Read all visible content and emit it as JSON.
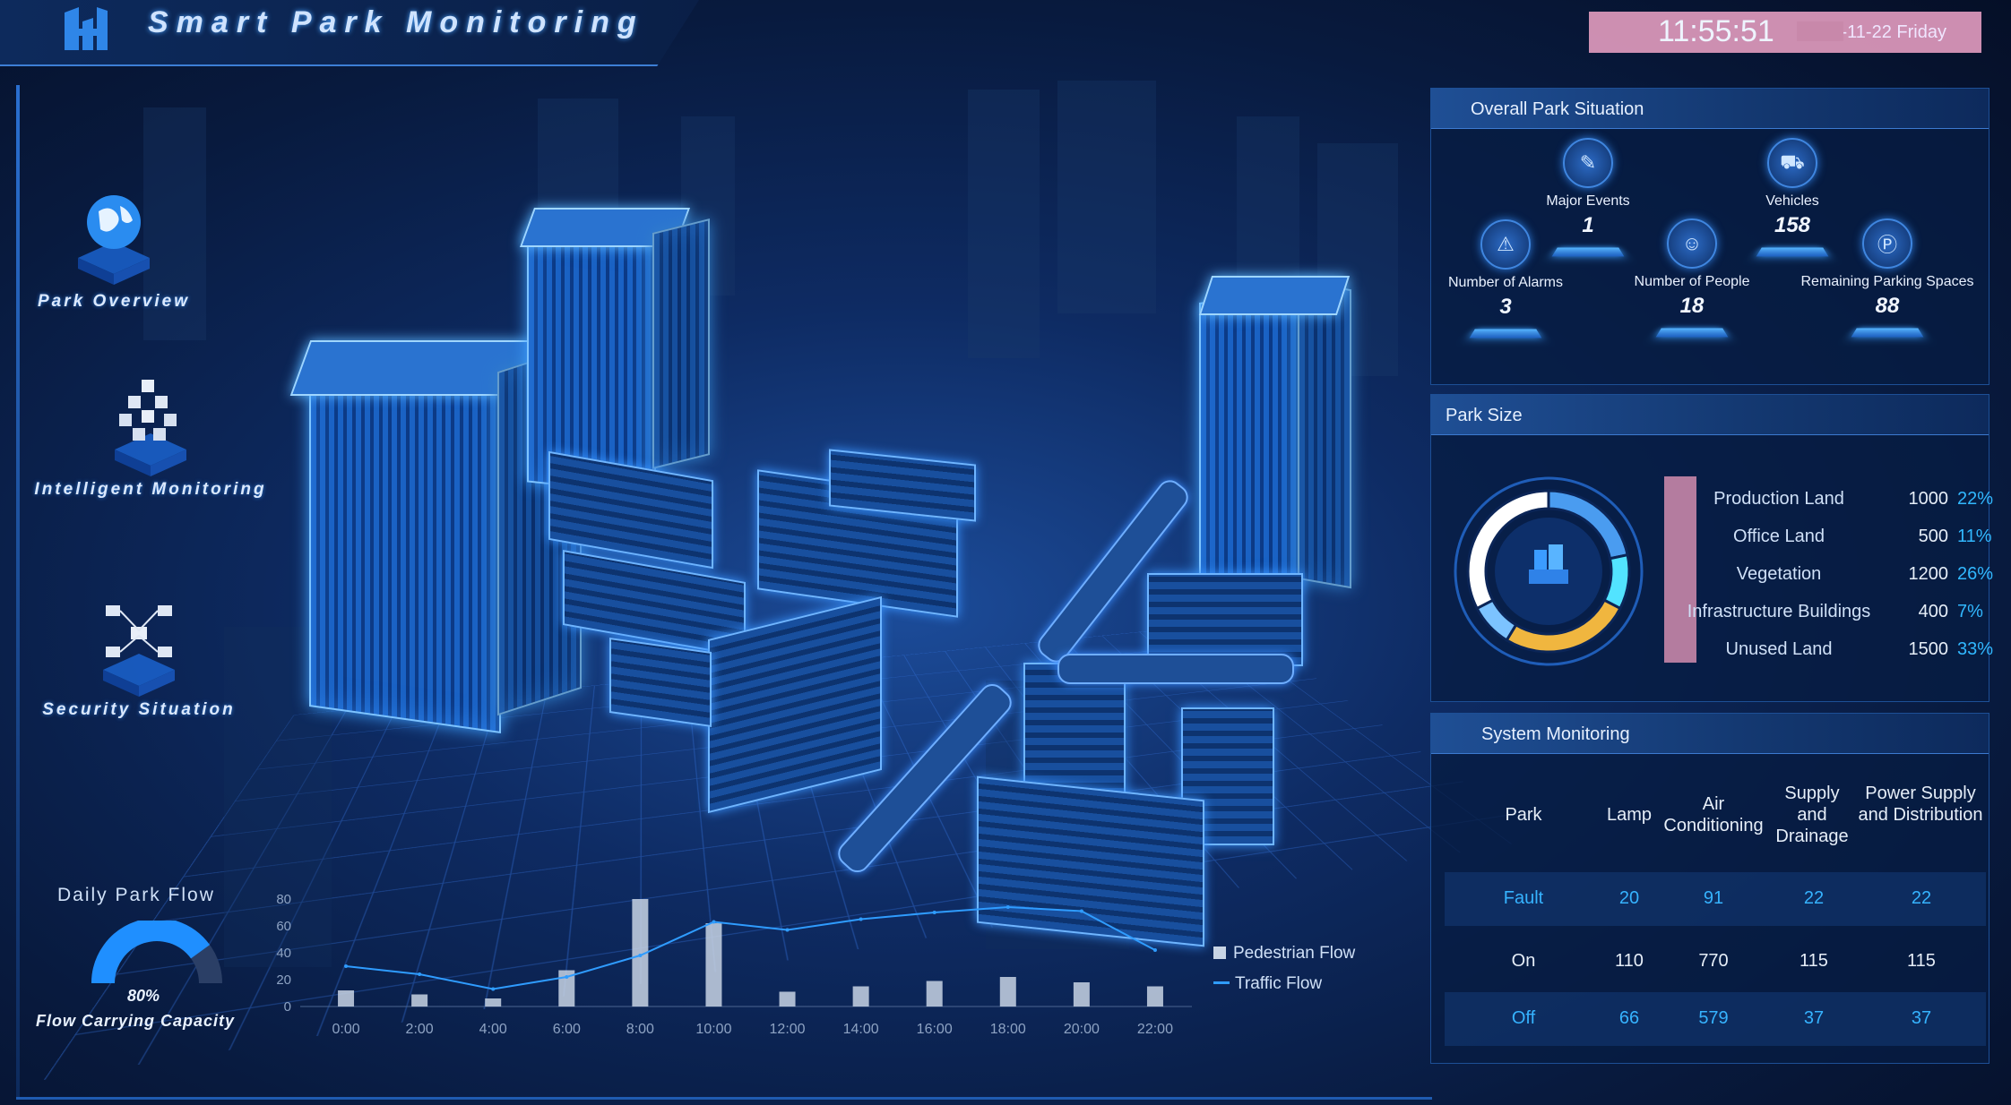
{
  "header": {
    "title": "Smart Park Monitoring",
    "time": "11:55:51",
    "date": "2023-11-22 Friday"
  },
  "nav": {
    "items": [
      {
        "label": "Park Overview",
        "icon": "globe-icon"
      },
      {
        "label": "Intelligent Monitoring",
        "icon": "cube-cluster-icon"
      },
      {
        "label": "Security Situation",
        "icon": "network-icon"
      }
    ]
  },
  "overall": {
    "title": "Overall Park Situation",
    "stats": [
      {
        "label": "Number of Alarms",
        "value": "3",
        "icon": "alarm-icon"
      },
      {
        "label": "Major Events",
        "value": "1",
        "icon": "event-icon"
      },
      {
        "label": "Number of People",
        "value": "18",
        "icon": "people-icon"
      },
      {
        "label": "Vehicles",
        "value": "158",
        "icon": "truck-icon"
      },
      {
        "label": "Remaining Parking Spaces",
        "value": "88",
        "icon": "parking-icon"
      }
    ]
  },
  "park_size": {
    "title": "Park Size",
    "rows": [
      {
        "name": "Production Land",
        "value": "1000",
        "pct": "22%",
        "color": "#4a9cf0"
      },
      {
        "name": "Office Land",
        "value": "500",
        "pct": "11%",
        "color": "#52e3ff"
      },
      {
        "name": "Vegetation",
        "value": "1200",
        "pct": "26%",
        "color": "#f0b63f"
      },
      {
        "name": "Infrastructure Buildings",
        "value": "400",
        "pct": "7%",
        "color": "#7cc3ff"
      },
      {
        "name": "Unused Land",
        "value": "1500",
        "pct": "33%",
        "color": "#ffffff"
      }
    ]
  },
  "system": {
    "title": "System Monitoring",
    "headers": [
      "Park",
      "Lamp",
      "Air Conditioning",
      "Supply and Drainage",
      "Power Supply and Distribution"
    ],
    "rows": [
      {
        "cells": [
          "Fault",
          "20",
          "91",
          "22",
          "22"
        ],
        "color": "#36b3ff"
      },
      {
        "cells": [
          "On",
          "110",
          "770",
          "115",
          "115"
        ],
        "color": "#e6eef8"
      },
      {
        "cells": [
          "Off",
          "66",
          "579",
          "37",
          "37"
        ],
        "color": "#36b3ff"
      }
    ]
  },
  "flow": {
    "title": "Daily Park Flow",
    "gauge_value": "80%",
    "gauge_fraction": 0.8,
    "gauge_label": "Flow Carrying Capacity",
    "legend": [
      "Pedestrian Flow",
      "Traffic Flow"
    ]
  },
  "chart_data": {
    "type": "bar",
    "categories": [
      "0:00",
      "2:00",
      "4:00",
      "6:00",
      "8:00",
      "10:00",
      "12:00",
      "14:00",
      "16:00",
      "18:00",
      "20:00",
      "22:00"
    ],
    "series": [
      {
        "name": "Pedestrian Flow",
        "type": "bar",
        "values": [
          12,
          9,
          6,
          27,
          80,
          62,
          11,
          15,
          19,
          22,
          18,
          15
        ]
      },
      {
        "name": "Traffic Flow",
        "type": "line",
        "values": [
          30,
          24,
          13,
          22,
          38,
          63,
          57,
          65,
          70,
          74,
          71,
          42
        ]
      }
    ],
    "yticks": [
      "0",
      "20",
      "40",
      "60",
      "80"
    ],
    "ylim": [
      0,
      80
    ],
    "legend_position": "right",
    "colors": {
      "bar": "#c8d4e4",
      "line": "#2f9cff"
    }
  }
}
